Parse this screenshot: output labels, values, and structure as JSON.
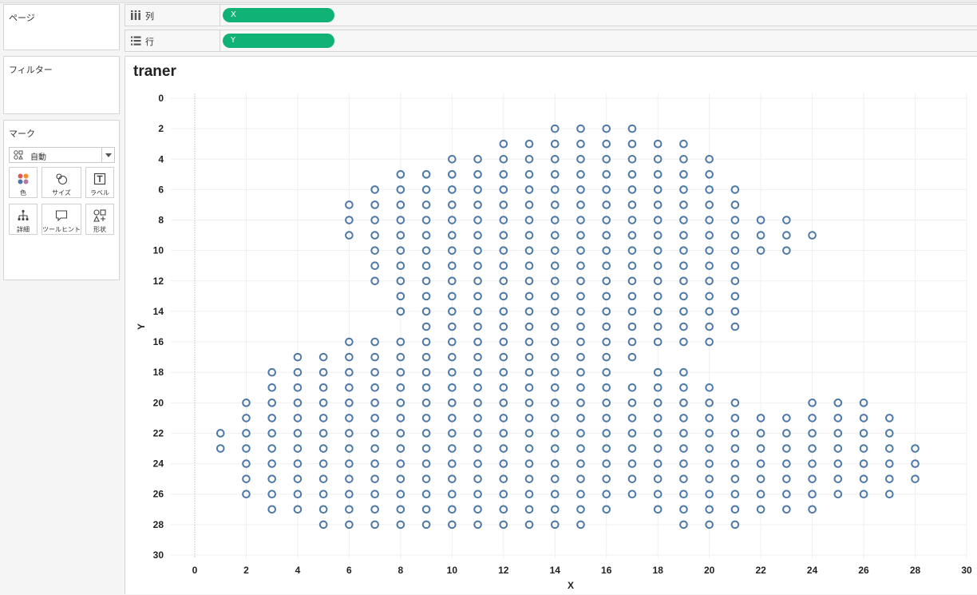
{
  "cards": {
    "pages": "ページ",
    "filters": "フィルター",
    "marks": "マーク"
  },
  "marks": {
    "type_label": "自動",
    "buttons": {
      "color": "色",
      "size": "サイズ",
      "label": "ラベル",
      "detail": "詳細",
      "tooltip": "ツールヒント",
      "shape": "形状"
    },
    "icons": {
      "color": "color-dots-icon",
      "size": "size-circles-icon",
      "label": "text-label-icon",
      "detail": "detail-tree-icon",
      "tooltip": "speech-bubble-icon",
      "shape": "shapes-icon"
    }
  },
  "shelves": {
    "columns": {
      "label": "列",
      "pill": "X"
    },
    "rows": {
      "label": "行",
      "pill": "Y"
    }
  },
  "pill_color": "#10b275",
  "sheet_title": "traner",
  "chart_data": {
    "type": "scatter",
    "title": "traner",
    "xlabel": "X",
    "ylabel": "Y",
    "xlim": [
      0,
      30
    ],
    "ylim": [
      30,
      0
    ],
    "y_reversed": true,
    "x_ticks": [
      0,
      2,
      4,
      6,
      8,
      10,
      12,
      14,
      16,
      18,
      20,
      22,
      24,
      26,
      28,
      30
    ],
    "y_ticks": [
      0,
      2,
      4,
      6,
      8,
      10,
      12,
      14,
      16,
      18,
      20,
      22,
      24,
      26,
      28,
      30
    ],
    "marker": "open-circle",
    "marker_color": "#4e79a7",
    "rows": [
      {
        "y": 2,
        "x": [
          [
            14,
            17
          ]
        ]
      },
      {
        "y": 3,
        "x": [
          [
            12,
            19
          ]
        ]
      },
      {
        "y": 4,
        "x": [
          [
            10,
            20
          ]
        ]
      },
      {
        "y": 5,
        "x": [
          [
            8,
            20
          ]
        ]
      },
      {
        "y": 6,
        "x": [
          [
            7,
            21
          ]
        ]
      },
      {
        "y": 7,
        "x": [
          [
            6,
            21
          ]
        ]
      },
      {
        "y": 8,
        "x": [
          [
            6,
            23
          ]
        ]
      },
      {
        "y": 9,
        "x": [
          [
            6,
            24
          ]
        ]
      },
      {
        "y": 10,
        "x": [
          [
            7,
            23
          ]
        ]
      },
      {
        "y": 11,
        "x": [
          [
            7,
            21
          ]
        ]
      },
      {
        "y": 12,
        "x": [
          [
            7,
            21
          ]
        ]
      },
      {
        "y": 13,
        "x": [
          [
            8,
            21
          ]
        ]
      },
      {
        "y": 14,
        "x": [
          [
            8,
            21
          ]
        ]
      },
      {
        "y": 15,
        "x": [
          [
            9,
            21
          ]
        ]
      },
      {
        "y": 16,
        "x": [
          [
            6,
            20
          ]
        ]
      },
      {
        "y": 17,
        "x": [
          [
            4,
            17
          ]
        ]
      },
      {
        "y": 18,
        "x": [
          [
            3,
            16
          ],
          [
            18,
            19
          ]
        ]
      },
      {
        "y": 19,
        "x": [
          [
            3,
            20
          ]
        ]
      },
      {
        "y": 20,
        "x": [
          [
            2,
            21
          ],
          [
            24,
            26
          ]
        ]
      },
      {
        "y": 21,
        "x": [
          [
            2,
            27
          ]
        ]
      },
      {
        "y": 22,
        "x": [
          [
            1,
            27
          ]
        ]
      },
      {
        "y": 23,
        "x": [
          [
            1,
            28
          ]
        ]
      },
      {
        "y": 24,
        "x": [
          [
            2,
            28
          ]
        ]
      },
      {
        "y": 25,
        "x": [
          [
            2,
            28
          ]
        ]
      },
      {
        "y": 26,
        "x": [
          [
            2,
            27
          ]
        ]
      },
      {
        "y": 27,
        "x": [
          [
            3,
            16
          ],
          [
            18,
            24
          ]
        ]
      },
      {
        "y": 28,
        "x": [
          [
            5,
            15
          ],
          [
            19,
            21
          ]
        ]
      }
    ]
  }
}
